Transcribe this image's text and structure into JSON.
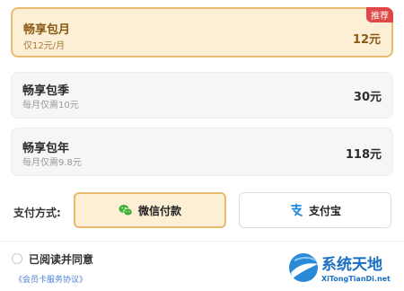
{
  "plans": [
    {
      "name": "畅享包月",
      "desc": "仅12元/月",
      "price": "12元",
      "badge": "推荐",
      "selected": true
    },
    {
      "name": "畅享包季",
      "desc": "每月仅需10元",
      "price": "30元",
      "selected": false
    },
    {
      "name": "畅享包年",
      "desc": "每月仅需9.8元",
      "price": "118元",
      "selected": false
    }
  ],
  "payment": {
    "label": "支付方式:",
    "options": [
      {
        "label": "微信付款",
        "icon": "wechat-icon",
        "selected": true
      },
      {
        "label": "支付宝",
        "icon": "alipay-icon",
        "selected": false
      }
    ]
  },
  "agreement": {
    "text": "已阅读并同意",
    "link": "《会员卡服务协议》"
  },
  "watermark": {
    "title": "系统天地",
    "domain": "XiTongTianDi.net"
  },
  "colors": {
    "selected_bg": "#fcefd5",
    "selected_border": "#e8bb6e",
    "badge": "#e24747",
    "link": "#4a7fd6",
    "wechat": "#3cb034",
    "alipay": "#1f8be0"
  }
}
